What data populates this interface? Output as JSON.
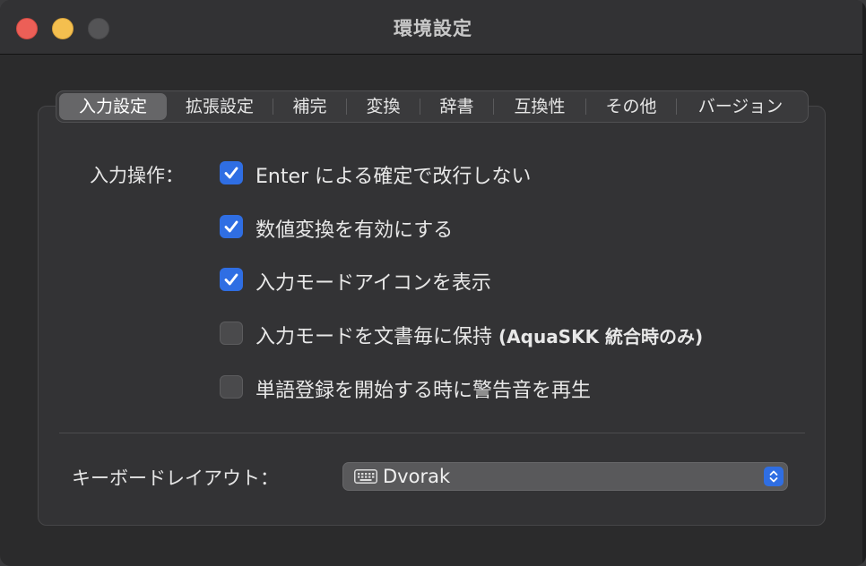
{
  "window": {
    "title": "環境設定"
  },
  "tabs": [
    {
      "label": "入力設定",
      "active": true
    },
    {
      "label": "拡張設定",
      "active": false
    },
    {
      "label": "補完",
      "active": false
    },
    {
      "label": "変換",
      "active": false
    },
    {
      "label": "辞書",
      "active": false
    },
    {
      "label": "互換性",
      "active": false
    },
    {
      "label": "その他",
      "active": false
    },
    {
      "label": "バージョン",
      "active": false
    }
  ],
  "input_ops": {
    "label": "入力操作：",
    "options": [
      {
        "label": "Enter による確定で改行しない",
        "checked": true
      },
      {
        "label": "数値変換を有効にする",
        "checked": true
      },
      {
        "label": "入力モードアイコンを表示",
        "checked": true
      },
      {
        "label": "入力モードを文書毎に保持",
        "note": "(AquaSKK 統合時のみ)",
        "checked": false
      },
      {
        "label": "単語登録を開始する時に警告音を再生",
        "checked": false
      }
    ]
  },
  "keyboard_layout": {
    "label": "キーボードレイアウト：",
    "value": "Dvorak",
    "icon": "keyboard-icon"
  },
  "colors": {
    "accent": "#2f6ee3",
    "close": "#ec5f57",
    "minimize": "#f4bf4f",
    "zoom": "#545456"
  }
}
